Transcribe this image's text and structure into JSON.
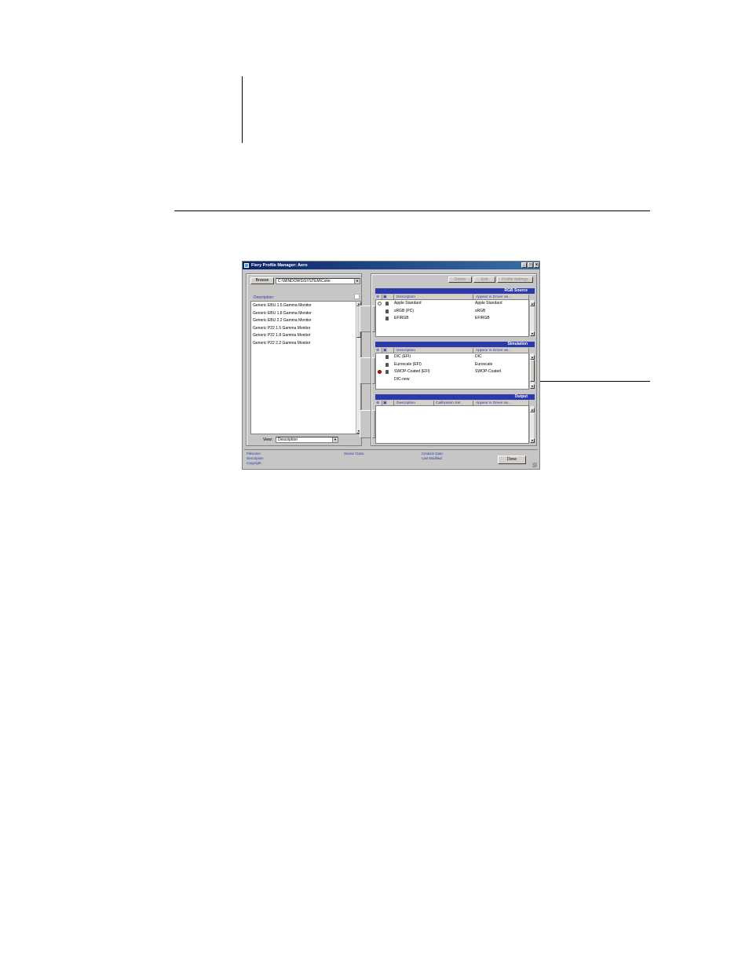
{
  "window": {
    "title": "Fiery Profile Manager: Aero",
    "controls": {
      "minimize": "_",
      "maximize": "□",
      "close": "x"
    }
  },
  "left": {
    "browse_label": "Browse",
    "path_value": "C:\\WINDOWS\\SYSTEM\\Color",
    "list_header": "Description",
    "items": [
      "Generic EBU 1.5 Gamma Monitor",
      "Generic EBU 1.8 Gamma Monitor",
      "Generic EBU 2.2 Gamma Monitor",
      "Generic P22 1.5 Gamma Monitor",
      "Generic P22 1.8 Gamma Monitor",
      "Generic P22 2.2 Gamma Monitor"
    ],
    "view_label": "View:",
    "view_value": "Description"
  },
  "toolbar": {
    "delete_label": "Delete",
    "edit_label": "Edit",
    "profile_settings_label": "Profile Settings"
  },
  "rgb_source": {
    "title": "RGB Source",
    "headers": {
      "description": "Description",
      "appear": "Appear in Driver as..."
    },
    "rows": [
      {
        "description": "Apple Standard",
        "appear": "Apple Standard",
        "star": "default",
        "lock": true
      },
      {
        "description": "sRGB (PC)",
        "appear": "sRGB",
        "star": "none",
        "lock": true
      },
      {
        "description": "EFIRGB",
        "appear": "EFIRGB",
        "star": "none",
        "lock": true
      }
    ]
  },
  "simulation": {
    "title": "Simulation",
    "headers": {
      "description": "Description",
      "appear": "Appear in Driver as..."
    },
    "rows": [
      {
        "description": "DIC (EFI)",
        "appear": "DIC",
        "star": "none",
        "lock": true
      },
      {
        "description": "Euroscale (EFI)",
        "appear": "Euroscale",
        "star": "none",
        "lock": true
      },
      {
        "description": "SWOP-Coated (EFI)",
        "appear": "SWOP-Coated",
        "star": "active",
        "lock": true
      },
      {
        "description": "DIC-new",
        "appear": "",
        "star": "none",
        "lock": false
      }
    ]
  },
  "output": {
    "title": "Output",
    "headers": {
      "description": "Description",
      "calibration": "Calibration Set",
      "appear": "Appear in Driver as..."
    },
    "rows": []
  },
  "status": {
    "filename": "Filename:",
    "description": "Description:",
    "copyright": "Copyright:",
    "device_class": "Device Class:",
    "creation_date": "Creation Date:",
    "last_modified": "Last Modified:",
    "done_label": "Done"
  },
  "colors": {
    "title_bar": "#0a246a",
    "section_bar": "#2b3aa8",
    "header_text": "#2a3aa0",
    "active_marker": "#c01818"
  }
}
